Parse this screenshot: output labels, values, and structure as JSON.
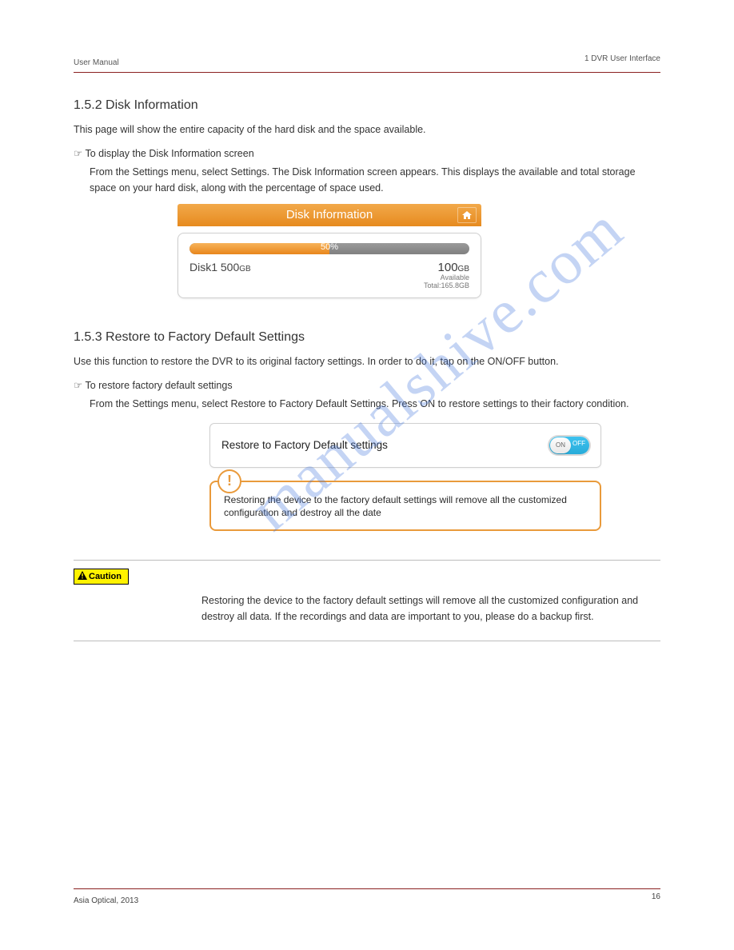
{
  "header": {
    "left": "User Manual",
    "right": "1 DVR User Interface"
  },
  "section1": {
    "title": "1.5.2 Disk Information",
    "body": "This page will show the entire capacity of the hard disk and the space available.",
    "pointer": "To display the Disk Information screen",
    "indent": "From the Settings menu, select Settings. The Disk Information screen appears. This displays the available and total storage space on your hard disk, along with the percentage of space used."
  },
  "disk": {
    "panel_title": "Disk Information",
    "percent_label": "50%",
    "name": "Disk1 500",
    "name_unit": "GB",
    "free": "100",
    "free_unit": "GB",
    "available_label": "Available",
    "total_label": "Total:165.8GB"
  },
  "section2": {
    "title": "1.5.3 Restore to Factory Default Settings",
    "body": "Use this function to restore the DVR to its original factory settings. In order to do it, tap on the ON/OFF button.",
    "pointer": "To restore factory default settings",
    "indent": "From the Settings menu, select Restore to Factory Default Settings. Press ON to restore settings to their factory condition."
  },
  "factory": {
    "label": "Restore to Factory Default settings",
    "toggle_on": "ON",
    "toggle_off": "OFF",
    "warning": "Restoring the device to the factory default settings will remove all the customized configuration and destroy all the date"
  },
  "caution": {
    "badge": "Caution",
    "body": "Restoring the device to the factory default settings will remove all the customized configuration and destroy all data. If the recordings and data are important to you, please do a backup first."
  },
  "footer": {
    "left": "Asia Optical, 2013",
    "right": "16"
  },
  "watermark": "manualshive.com"
}
